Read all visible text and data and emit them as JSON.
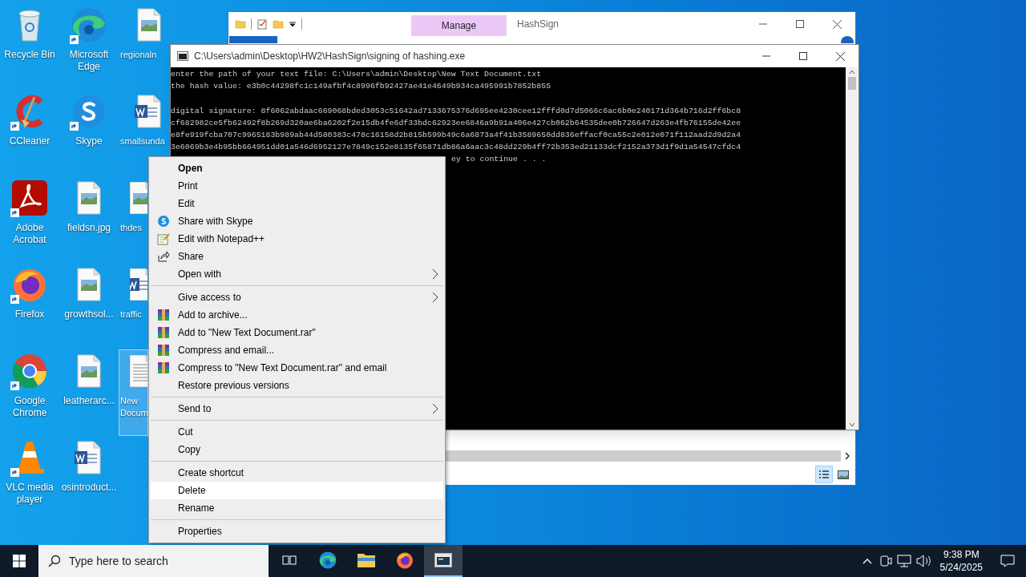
{
  "desktop": {
    "columns": [
      [
        {
          "label": "Recycle Bin",
          "kind": "recycle",
          "selected": false
        },
        {
          "label": "CCleaner",
          "kind": "ccleaner",
          "selected": false
        },
        {
          "label": "Adobe Acrobat",
          "kind": "acrobat",
          "selected": false
        },
        {
          "label": "Firefox",
          "kind": "firefox",
          "selected": false
        },
        {
          "label": "Google Chrome",
          "kind": "chrome",
          "selected": false
        },
        {
          "label": "VLC media player",
          "kind": "vlc",
          "selected": false
        }
      ],
      [
        {
          "label": "Microsoft Edge",
          "kind": "edge",
          "selected": false
        },
        {
          "label": "Skype",
          "kind": "skype",
          "selected": false
        },
        {
          "label": "fieldsn.jpg",
          "kind": "image",
          "selected": false
        },
        {
          "label": "growthsol...",
          "kind": "image",
          "selected": false
        },
        {
          "label": "leatherarc...",
          "kind": "image",
          "selected": false
        },
        {
          "label": "osintroduct...",
          "kind": "word",
          "selected": false
        }
      ],
      [
        {
          "label": "regionaln",
          "kind": "image",
          "selected": false
        },
        {
          "label": "smallsunda",
          "kind": "word",
          "selected": false
        },
        {
          "label": "thdes",
          "kind": "image",
          "selected": false
        },
        {
          "label": "traffic",
          "kind": "word",
          "selected": false
        },
        {
          "label": "New\nDocum",
          "kind": "text",
          "selected": true
        }
      ]
    ]
  },
  "explorer": {
    "title": "HashSign",
    "context_tab": "Manage"
  },
  "console": {
    "title": "C:\\Users\\admin\\Desktop\\HW2\\HashSign\\signing of hashing.exe",
    "lines": [
      "enter the path of your text file: C:\\Users\\admin\\Desktop\\New Text Document.txt",
      "the hash value: e3b0c44298fc1c149afbf4c8996fb92427ae41e4649b934ca495991b7852b855"
    ],
    "signature_lines": [
      "digital signature: 8f6062abdaac669068bded3053c51642ad7133675376d695ee4230cee12fffd0d7d5066c6ac6b0e240171d364b716d2ff6bc8",
      "cf682982ce5fb62492f8b269d320ae6ba6202f2e15db4fe6df33bdc62923ee6846a9b91a406e427cb062b64535dee0b726647d263e4fb76155de42ee",
      "e8fe919fcba707c9965183b989ab44d580383c478c16158d2b815b599b49c6a6873a4f41b3589650dd836effacf0ca55c2e012e071f112aad2d9d2a4",
      "3e6069b3e4b95bb664951dd01a546d6952127e7849c152e8135f65871db86a6aac3c48dd229b4ff72b353ed21133dcf2152a373d1f9d1a54547cfdc4"
    ],
    "partial_line": "ey to continue . . ."
  },
  "menu": {
    "groups": [
      {
        "items": [
          {
            "label": "Open",
            "kind": "plain",
            "default": true,
            "submenu": false,
            "selected": false
          },
          {
            "label": "Print",
            "kind": "plain",
            "default": false,
            "submenu": false,
            "selected": false
          },
          {
            "label": "Edit",
            "kind": "plain",
            "default": false,
            "submenu": false,
            "selected": false
          },
          {
            "label": "Share with Skype",
            "kind": "skype",
            "default": false,
            "submenu": false,
            "selected": false
          },
          {
            "label": "Edit with Notepad++",
            "kind": "notepad",
            "default": false,
            "submenu": false,
            "selected": false
          },
          {
            "label": "Share",
            "kind": "share",
            "default": false,
            "submenu": false,
            "selected": false
          },
          {
            "label": "Open with",
            "kind": "plain",
            "default": false,
            "submenu": true,
            "selected": false
          }
        ]
      },
      {
        "items": [
          {
            "label": "Give access to",
            "kind": "plain",
            "default": false,
            "submenu": true,
            "selected": false
          },
          {
            "label": "Add to archive...",
            "kind": "archive",
            "default": false,
            "submenu": false,
            "selected": false
          },
          {
            "label": "Add to \"New Text Document.rar\"",
            "kind": "archive",
            "default": false,
            "submenu": false,
            "selected": false
          },
          {
            "label": "Compress and email...",
            "kind": "archive",
            "default": false,
            "submenu": false,
            "selected": false
          },
          {
            "label": "Compress to \"New Text Document.rar\" and email",
            "kind": "archive",
            "default": false,
            "submenu": false,
            "selected": false
          },
          {
            "label": "Restore previous versions",
            "kind": "plain",
            "default": false,
            "submenu": false,
            "selected": false
          }
        ]
      },
      {
        "items": [
          {
            "label": "Send to",
            "kind": "plain",
            "default": false,
            "submenu": true,
            "selected": false
          }
        ]
      },
      {
        "items": [
          {
            "label": "Cut",
            "kind": "plain",
            "default": false,
            "submenu": false,
            "selected": false
          },
          {
            "label": "Copy",
            "kind": "plain",
            "default": false,
            "submenu": false,
            "selected": false
          }
        ]
      },
      {
        "items": [
          {
            "label": "Create shortcut",
            "kind": "plain",
            "default": false,
            "submenu": false,
            "selected": false
          },
          {
            "label": "Delete",
            "kind": "plain",
            "default": false,
            "submenu": false,
            "selected": true
          },
          {
            "label": "Rename",
            "kind": "plain",
            "default": false,
            "submenu": false,
            "selected": false
          }
        ]
      },
      {
        "items": [
          {
            "label": "Properties",
            "kind": "plain",
            "default": false,
            "submenu": false,
            "selected": false
          }
        ]
      }
    ]
  },
  "taskbar": {
    "search": {
      "placeholder": "Type here to search"
    },
    "apps": [
      {
        "kind": "taskview",
        "selected": false
      },
      {
        "kind": "edge",
        "selected": false
      },
      {
        "kind": "explorer",
        "selected": false
      },
      {
        "kind": "firefox",
        "selected": false
      },
      {
        "kind": "console",
        "selected": true
      }
    ],
    "time": "9:38 PM",
    "date": "5/24/2025"
  }
}
